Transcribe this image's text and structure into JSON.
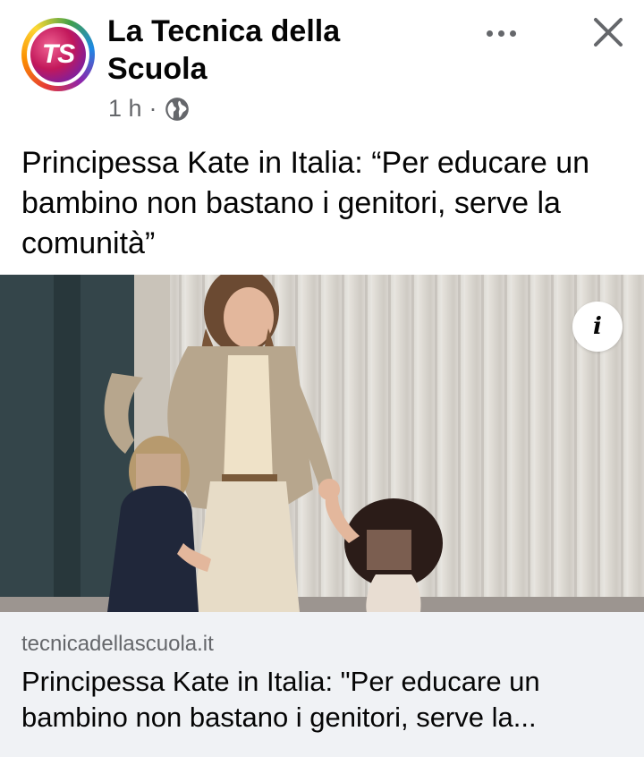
{
  "post": {
    "page_name": "La Tecnica della Scuola",
    "avatar_text": "TS",
    "timestamp": "1 h",
    "separator": "·",
    "audience_icon": "globe-icon",
    "more_icon": "more-horizontal-icon",
    "close_icon": "close-icon",
    "text": "Principessa Kate in Italia: “Per educare un bambino non bastano i genitori, serve la comunità”"
  },
  "link_preview": {
    "info_icon": "info-icon",
    "info_label": "i",
    "domain": "tecnicadellascuola.it",
    "title": "Principessa Kate in Italia: \"Per educare un bambino non bastano i genitori, serve la..."
  },
  "colors": {
    "text_primary": "#050505",
    "text_secondary": "#65676b",
    "link_footer_bg": "#f0f2f5"
  }
}
